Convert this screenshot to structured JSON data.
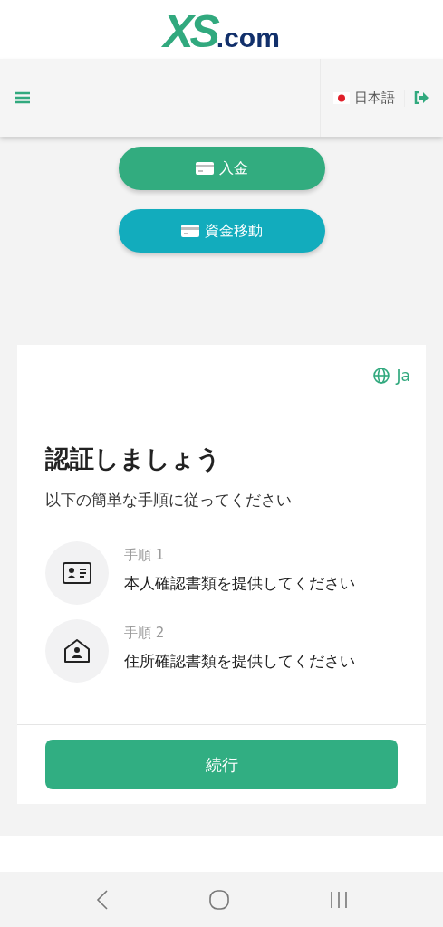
{
  "logo": {
    "mark": "XS",
    "suffix": ".com"
  },
  "toolbar": {
    "language": "日本語"
  },
  "actions": [
    {
      "label": "入金",
      "kind": "deposit"
    },
    {
      "label": "資金移動",
      "kind": "transfer"
    }
  ],
  "card": {
    "language": "Ja",
    "title": "認証しましょう",
    "subtitle": "以下の簡単な手順に従ってください",
    "steps": [
      {
        "label": "手順 1",
        "text": "本人確認書類を提供してください",
        "kind": "id"
      },
      {
        "label": "手順 2",
        "text": "住所確認書類を提供してください",
        "kind": "address"
      }
    ],
    "button": "続行"
  }
}
